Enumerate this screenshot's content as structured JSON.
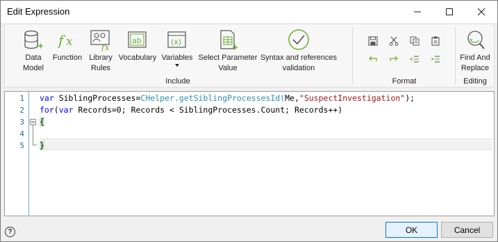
{
  "window": {
    "title": "Edit Expression"
  },
  "ribbon": {
    "include": {
      "label": "Include",
      "buttons": [
        {
          "label": "Data\nModel",
          "icon": "database-icon"
        },
        {
          "label": "Function",
          "icon": "fx-icon"
        },
        {
          "label": "Library\nRules",
          "icon": "library-rules-icon"
        },
        {
          "label": "Vocabulary",
          "icon": "ab-icon"
        },
        {
          "label": "Variables",
          "icon": "variable-icon"
        },
        {
          "label": "Select Parameter\nValue",
          "icon": "table-param-icon"
        },
        {
          "label": "Syntax and references\nvalidation",
          "icon": "check-circle-icon"
        }
      ]
    },
    "format": {
      "label": "Format"
    },
    "editing": {
      "label": "Editing",
      "find_replace": "Find And\nReplace"
    }
  },
  "editor": {
    "line_numbers": [
      "1",
      "2",
      "3",
      "4",
      "5"
    ],
    "lines": {
      "l1": {
        "kw": "var",
        "var": " SiblingProcesses=",
        "cls": "CHelper.getSiblingProcessesId(",
        "args_me": "Me,",
        "str": "\"SuspectInvestigation\"",
        "end": ");"
      },
      "l2": {
        "kw1": "for",
        "p1": "(",
        "kw2": "var",
        "rest": " Records=0; Records < SiblingProcesses.Count; Records++)"
      },
      "l3": {
        "text": "{"
      },
      "l5": {
        "text": "}"
      }
    }
  },
  "footer": {
    "help": "?",
    "ok": "OK",
    "cancel": "Cancel"
  },
  "colors": {
    "keyword": "#0000ff",
    "class": "#2b91af",
    "string": "#a31515",
    "line_number": "#1e6f9b",
    "accent": "#0078d7"
  }
}
